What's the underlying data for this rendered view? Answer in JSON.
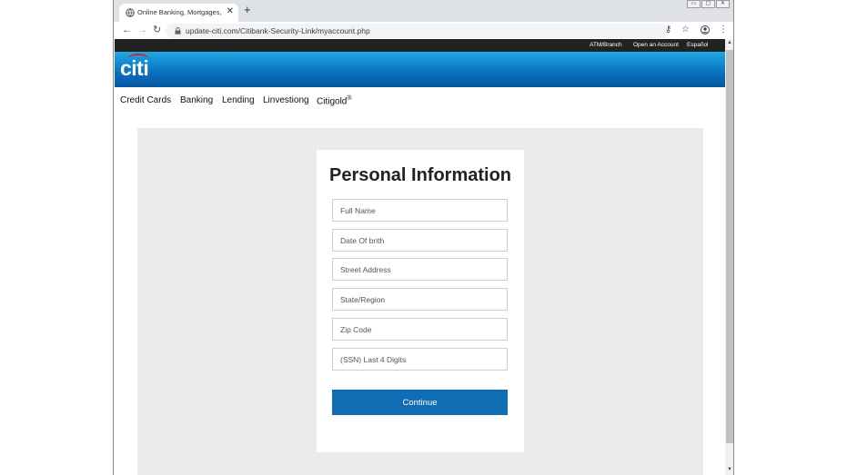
{
  "browser": {
    "tab_title": "Online Banking, Mortgages, Pers",
    "tab_close": "✕",
    "new_tab": "+",
    "url": "update-citi.com/Citibank-Security-Link/myaccount.php",
    "window_controls": [
      "▭",
      "▢",
      "✕"
    ]
  },
  "site": {
    "topbar": {
      "atm_branch": "ATM/Branch",
      "open_account": "Open an Account",
      "espanol": "Español"
    },
    "logo_text": "citi",
    "nav": [
      {
        "label": "Credit Cards"
      },
      {
        "label": "Banking"
      },
      {
        "label": "Lending"
      },
      {
        "label": "Linvestiong"
      },
      {
        "label": "Citigold",
        "sup": "®"
      }
    ]
  },
  "form": {
    "title": "Personal Information",
    "fields": [
      {
        "placeholder": "Full Name"
      },
      {
        "placeholder": "Date Of brith"
      },
      {
        "placeholder": "Street Address"
      },
      {
        "placeholder": "State/Region"
      },
      {
        "placeholder": "Zip Code"
      },
      {
        "placeholder": "(SSN) Last 4 Digits"
      }
    ],
    "continue_label": "Continue"
  },
  "colors": {
    "brand_blue": "#0f6db3",
    "logo_arc_red": "#e31d2b",
    "topbar_black": "#222222"
  }
}
